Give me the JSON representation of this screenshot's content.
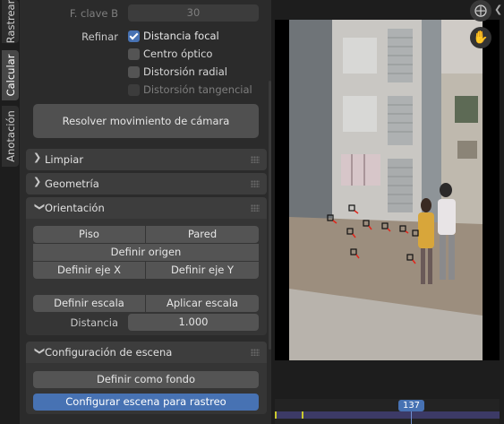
{
  "tabs": [
    {
      "label": "Rastrear",
      "active": false
    },
    {
      "label": "Calcular",
      "active": true
    },
    {
      "label": "Anotación",
      "active": false
    }
  ],
  "solve": {
    "keyframe_b_label": "F. clave B",
    "keyframe_b_value": "30",
    "refine_label": "Refinar",
    "options": [
      {
        "label": "Distancia focal",
        "checked": true,
        "enabled": true
      },
      {
        "label": "Centro óptico",
        "checked": false,
        "enabled": true
      },
      {
        "label": "Distorsión radial",
        "checked": false,
        "enabled": true
      },
      {
        "label": "Distorsión tangencial",
        "checked": false,
        "enabled": false
      }
    ],
    "solve_button": "Resolver movimiento de cámara"
  },
  "panels": {
    "cleanup": {
      "title": "Limpiar",
      "expanded": false
    },
    "geometry": {
      "title": "Geometría",
      "expanded": false
    },
    "orientation": {
      "title": "Orientación",
      "expanded": true,
      "floor": "Piso",
      "wall": "Pared",
      "set_origin": "Definir origen",
      "set_x": "Definir eje X",
      "set_y": "Definir eje Y",
      "set_scale": "Definir escala",
      "apply_scale": "Aplicar escala",
      "distance_label": "Distancia",
      "distance_value": "1.000"
    },
    "scene_setup": {
      "title": "Configuración de escena",
      "expanded": true,
      "set_background": "Definir como fondo",
      "setup_tracking": "Configurar escena para rastreo"
    }
  },
  "viewport": {
    "zoom_icon": "zoom-in-icon",
    "pan_icon": "hand-pan-icon",
    "collapse_icon": "chevron-left-icon"
  },
  "timeline": {
    "current_frame": "137"
  },
  "colors": {
    "accent": "#4772b3",
    "marker": "#e0261b"
  }
}
